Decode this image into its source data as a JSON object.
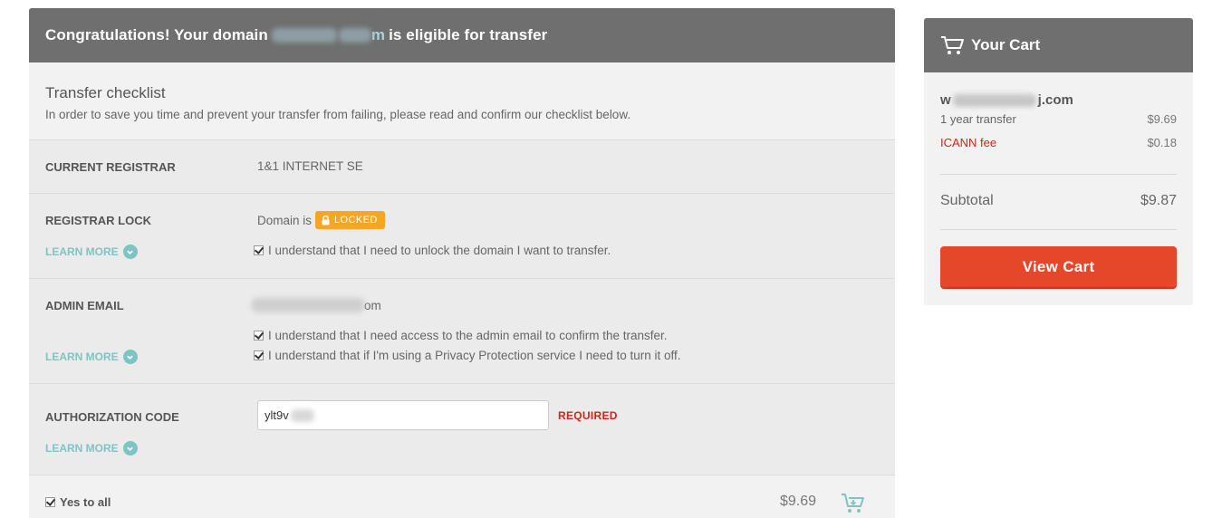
{
  "header": {
    "prefix": "Congratulations! Your domain",
    "domain_suffix": "m",
    "suffix": "is eligible for transfer"
  },
  "checklist": {
    "title": "Transfer checklist",
    "description": "In order to save you time and prevent your transfer from failing, please read and confirm our checklist below."
  },
  "rows": {
    "registrar": {
      "label": "CURRENT REGISTRAR",
      "value": "1&1 INTERNET SE"
    },
    "lock": {
      "label": "REGISTRAR LOCK",
      "learn_more": "LEARN MORE",
      "status_prefix": "Domain is",
      "badge": "LOCKED",
      "confirm": "I understand that I need to unlock the domain I want to transfer."
    },
    "admin": {
      "label": "ADMIN EMAIL",
      "email_suffix": "om",
      "learn_more": "LEARN MORE",
      "confirm1": "I understand that I need access to the admin email to confirm the transfer.",
      "confirm2": "I understand that if I'm using a Privacy Protection service I need to turn it off."
    },
    "auth": {
      "label": "AUTHORIZATION CODE",
      "value": "ylt9v",
      "required": "REQUIRED",
      "learn_more": "LEARN MORE"
    }
  },
  "footer": {
    "yes_all": "Yes to all",
    "price": "$9.69"
  },
  "cart": {
    "title": "Your Cart",
    "domain_prefix": "w",
    "domain_suffix": "j.com",
    "items": [
      {
        "label": "1 year transfer",
        "amount": "$9.69"
      },
      {
        "label": "ICANN fee",
        "amount": "$0.18"
      }
    ],
    "subtotal_label": "Subtotal",
    "subtotal": "$9.87",
    "button": "View Cart"
  },
  "colors": {
    "header_bg": "#6f6f6f",
    "accent_teal": "#7fc4c4",
    "locked": "#f5a623",
    "button": "#e4472a",
    "required": "#d0261a"
  },
  "icons": [
    "cart-icon",
    "lock-icon",
    "chevron-down-icon",
    "checkbox-checked-icon",
    "add-to-cart-icon"
  ]
}
